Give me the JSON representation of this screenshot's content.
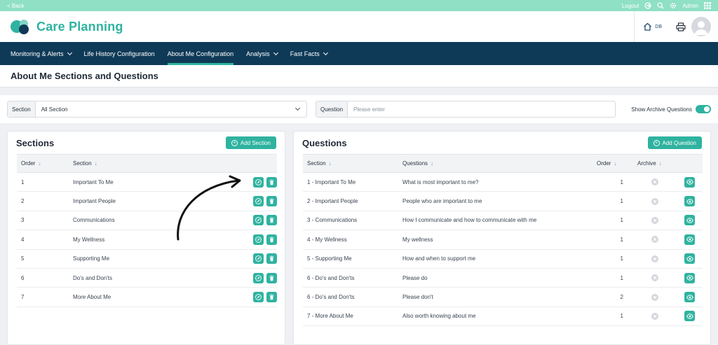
{
  "topbar": {
    "back": "< Back",
    "logout": "Logout",
    "admin": "Admin"
  },
  "header": {
    "app_title": "Care Planning",
    "home_label": "DB"
  },
  "nav": [
    {
      "label": "Monitoring & Alerts",
      "dropdown": true,
      "active": false
    },
    {
      "label": "Life History Configuration",
      "dropdown": false,
      "active": false
    },
    {
      "label": "About Me Configuration",
      "dropdown": false,
      "active": true
    },
    {
      "label": "Analysis",
      "dropdown": true,
      "active": false
    },
    {
      "label": "Fast Facts",
      "dropdown": true,
      "active": false
    }
  ],
  "page": {
    "title": "About Me Sections and Questions"
  },
  "filters": {
    "section_label": "Section",
    "section_value": "All Section",
    "question_label": "Question",
    "question_placeholder": "Please enter",
    "archive_label": "Show Archive Questions"
  },
  "sections_panel": {
    "title": "Sections",
    "add_label": "Add Section",
    "columns": [
      "Order",
      "Section"
    ],
    "rows": [
      {
        "order": "1",
        "section": "Important To Me"
      },
      {
        "order": "2",
        "section": "Important People"
      },
      {
        "order": "3",
        "section": "Communications"
      },
      {
        "order": "4",
        "section": "My Wellness"
      },
      {
        "order": "5",
        "section": "Supporting Me"
      },
      {
        "order": "6",
        "section": "Do's and Don'ts"
      },
      {
        "order": "7",
        "section": "More About Me"
      }
    ]
  },
  "questions_panel": {
    "title": "Questions",
    "add_label": "Add Question",
    "columns": [
      "Section",
      "Questions",
      "Order",
      "Archive"
    ],
    "rows": [
      {
        "section": "1 - Important To Me",
        "question": "What is most important to me?",
        "order": "1"
      },
      {
        "section": "2 - Important People",
        "question": "People who are important to me",
        "order": "1"
      },
      {
        "section": "3 - Communications",
        "question": "How I communicate and how to communicate with me",
        "order": "1"
      },
      {
        "section": "4 - My Wellness",
        "question": "My wellness",
        "order": "1"
      },
      {
        "section": "5 - Supporting Me",
        "question": "How and when to support me",
        "order": "1"
      },
      {
        "section": "6 - Do's and Don'ts",
        "question": "Please do",
        "order": "1"
      },
      {
        "section": "6 - Do's and Don'ts",
        "question": "Please don't",
        "order": "2"
      },
      {
        "section": "7 - More About Me",
        "question": "Also worth knowing about me",
        "order": "1"
      }
    ]
  },
  "colors": {
    "accent": "#2fb3a0",
    "nav_bg": "#0f3a57",
    "topbar_bg": "#8fe0c4"
  }
}
